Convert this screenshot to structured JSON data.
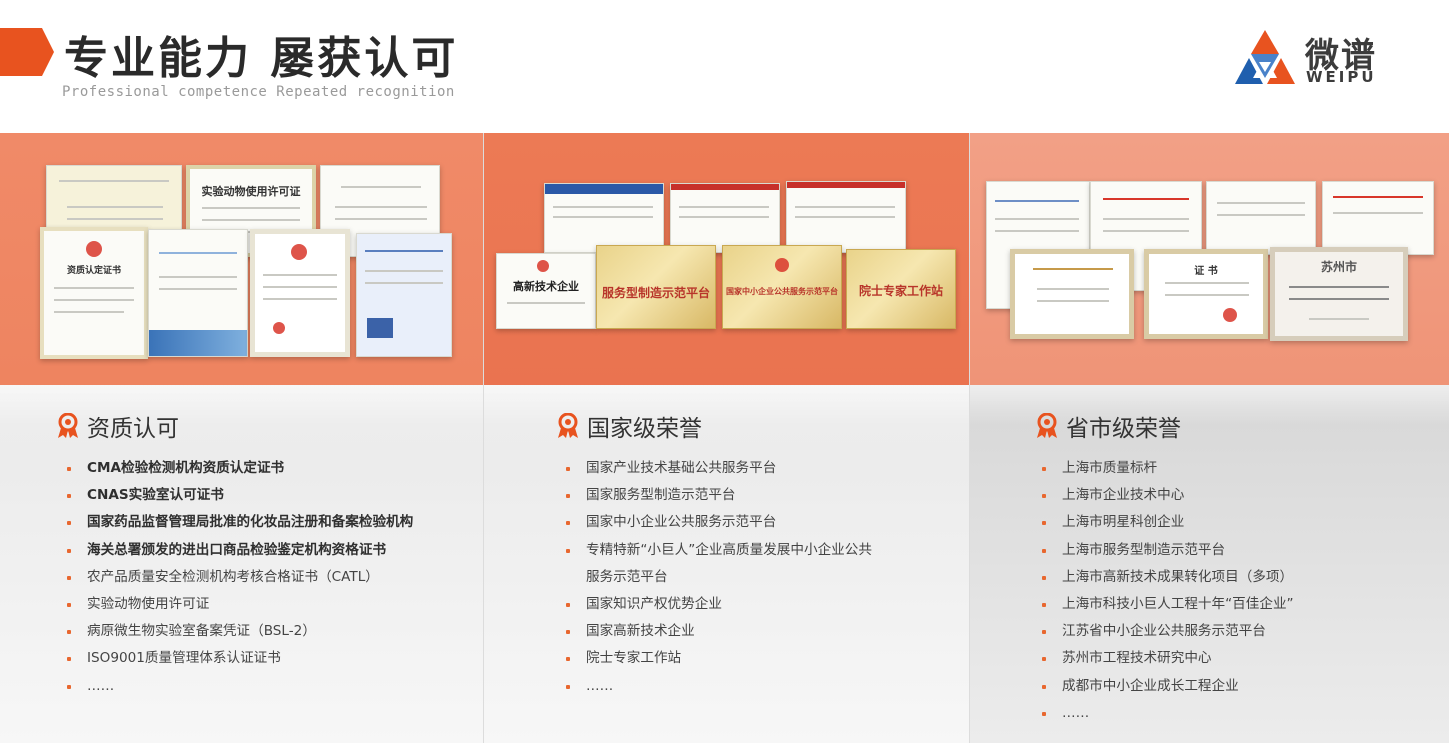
{
  "header": {
    "title": "专业能力 屡获认可",
    "subtitle": "Professional competence Repeated recognition",
    "logo_cn": "微谱",
    "logo_en": "WEIPU"
  },
  "colors": {
    "accent": "#e8531f",
    "band_1": "#f08a68",
    "band_2": "#ec7a55",
    "band_3": "#f2a086",
    "bullet": "#e8672f"
  },
  "icons": {
    "section_icon": "medal-icon",
    "logo_icon": "weipu-logo-icon"
  },
  "certificates": {
    "col1": {
      "animal_permit_title": "实验动物使用许可证",
      "qual_title": "资质认定证书"
    },
    "col2": {
      "gaoxin_title": "高新技术企业",
      "fuwu_title": "服务型制造示范平台",
      "zhongxiao_title": "国家中小企业公共服务示范平台",
      "yuanshi_title": "院士专家工作站"
    },
    "col3": {
      "zhengshu_title": "证 书",
      "suzhou_title": "苏州市"
    }
  },
  "sections": [
    {
      "title": "资质认可",
      "items": [
        {
          "text": "CMA检验检测机构资质认定证书",
          "bold": true
        },
        {
          "text": "CNAS实验室认可证书",
          "bold": true
        },
        {
          "text": "国家药品监督管理局批准的化妆品注册和备案检验机构",
          "bold": true
        },
        {
          "text": "海关总署颁发的进出口商品检验鉴定机构资格证书",
          "bold": true
        },
        {
          "text": "农产品质量安全检测机构考核合格证书（CATL）",
          "bold": false
        },
        {
          "text": "实验动物使用许可证",
          "bold": false
        },
        {
          "text": "病原微生物实验室备案凭证（BSL-2）",
          "bold": false
        },
        {
          "text": "ISO9001质量管理体系认证证书",
          "bold": false
        },
        {
          "text": "……",
          "bold": false
        }
      ]
    },
    {
      "title": "国家级荣誉",
      "items": [
        {
          "text": "国家产业技术基础公共服务平台"
        },
        {
          "text": "国家服务型制造示范平台"
        },
        {
          "text": "国家中小企业公共服务示范平台"
        },
        {
          "text": "专精特新“小巨人”企业高质量发展中小企业公共"
        },
        {
          "text": "服务示范平台",
          "continuation": true
        },
        {
          "text": "国家知识产权优势企业"
        },
        {
          "text": "国家高新技术企业"
        },
        {
          "text": "院士专家工作站"
        },
        {
          "text": "……"
        }
      ]
    },
    {
      "title": "省市级荣誉",
      "items": [
        {
          "text": "上海市质量标杆"
        },
        {
          "text": "上海市企业技术中心"
        },
        {
          "text": "上海市明星科创企业"
        },
        {
          "text": "上海市服务型制造示范平台"
        },
        {
          "text": "上海市高新技术成果转化项目（多项）"
        },
        {
          "text": "上海市科技小巨人工程十年“百佳企业”"
        },
        {
          "text": "江苏省中小企业公共服务示范平台"
        },
        {
          "text": "苏州市工程技术研究中心"
        },
        {
          "text": "成都市中小企业成长工程企业"
        },
        {
          "text": "……"
        }
      ]
    }
  ]
}
